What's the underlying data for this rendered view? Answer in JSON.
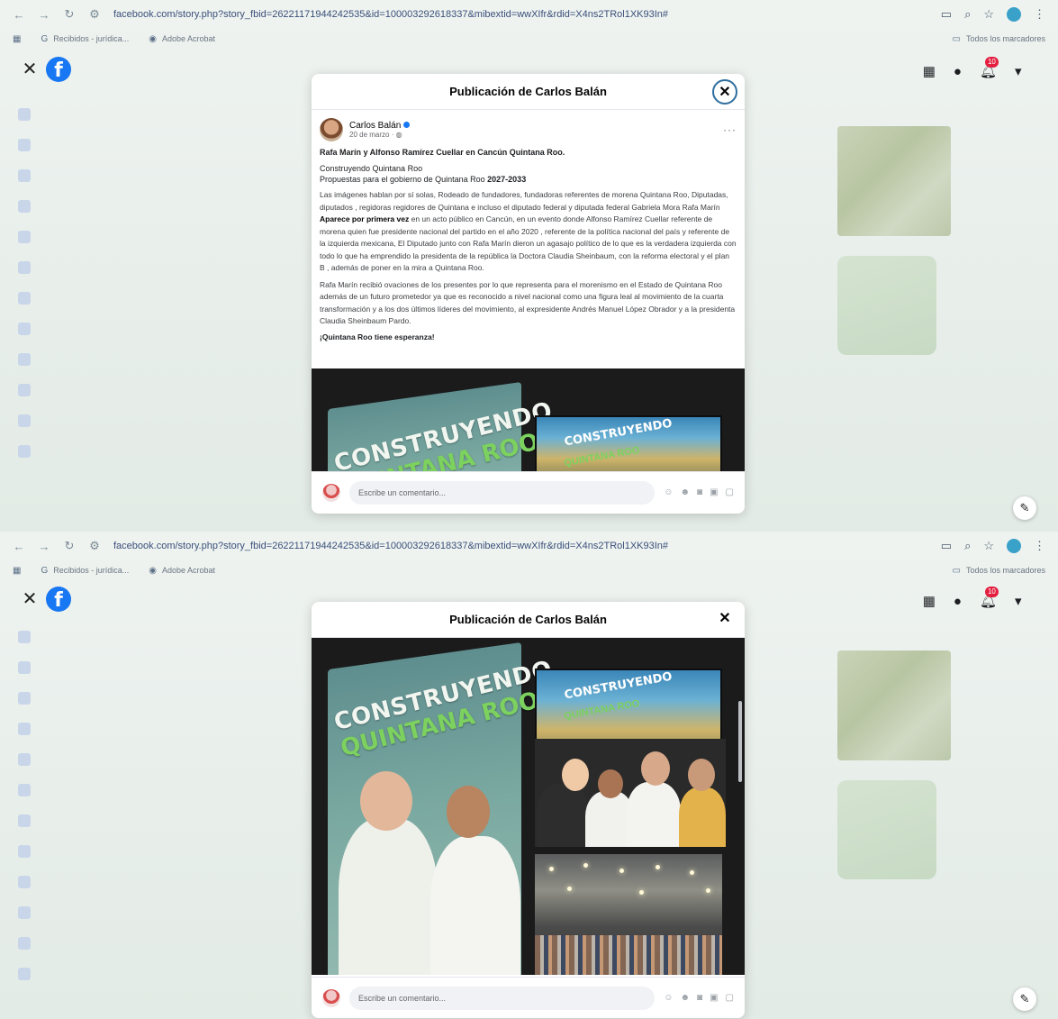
{
  "browser": {
    "url": "facebook.com/story.php?story_fbid=2622117194424253​5&id=100003292618337&mibextid=wwXIfr&rdid=X4ns2TRol1XK93In#",
    "bookmarks": [
      "Recibidos - jurídica...",
      "Adobe Acrobat"
    ],
    "all_bookmarks_label": "Todos los marcadores"
  },
  "facebook": {
    "logo_letter": "f",
    "notification_count": "10"
  },
  "modal": {
    "title": "Publicación de Carlos Balán",
    "close_glyph": "✕"
  },
  "post": {
    "author": "Carlos Balán",
    "date": "20 de marzo ·",
    "headline": "Rafa Marín y Alfonso Ramírez Cuellar en Cancún Quintana Roo.",
    "line1": "Construyendo Quintana Roo",
    "line2_text": "Propuestas para el gobierno de Quintana Roo",
    "line2_bold": "2027-2033",
    "para1_a": "Las imágenes hablan por sí solas, Rodeado de fundadores, fundadoras referentes de morena Quintana Roo, Diputadas, diputados , regidoras regidores de Quintana e incluso el diputado federal y diputada federal Gabriela Mora Rafa Marín",
    "para1_bold": "Aparece por primera vez",
    "para1_b": "en un acto público en Cancún, en un evento donde Alfonso Ramírez Cuellar referente de morena quien fue presidente nacional del partido en el año 2020 , referente de la política nacional del país y referente de la izquierda mexicana, El Diputado junto con Rafa Marín dieron un agasajo político de lo que es la verdadera izquierda con todo lo que ha emprendido la presidenta de la república la Doctora Claudia Sheinbaum, con la reforma electoral y el plan B , además de poner en la mira a Quintana Roo.",
    "para2": "Rafa Marín recibió ovaciones de los presentes por lo que representa para el morenismo en el Estado de Quintana Roo además de un futuro prometedor ya que es reconocido a nivel nacional como una figura leal al movimiento de la cuarta transformación y a los dos últimos líderes del movimiento, al expresidente Andrés Manuel López Obrador y a la presidenta Claudia Sheinbaum Pardo.",
    "closing": "¡Quintana Roo tiene esperanza!"
  },
  "photo": {
    "banner_line1": "CONSTRUYENDO",
    "banner_line2": "QUINTANA ROO",
    "screen_line1": "CONSTRUYENDO",
    "screen_line2": "QUINTANA ROO"
  },
  "comment": {
    "placeholder": "Escribe un comentario..."
  }
}
